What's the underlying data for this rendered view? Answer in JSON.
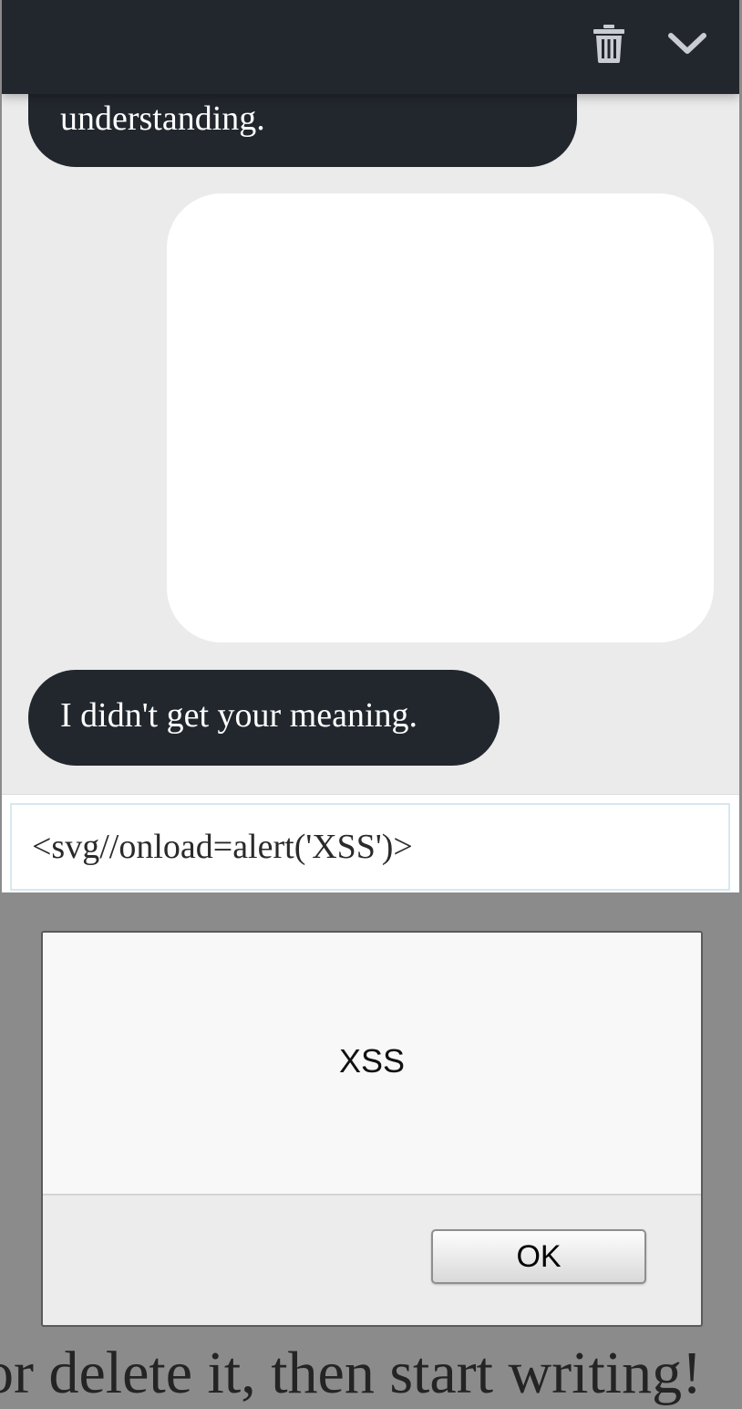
{
  "chat": {
    "header": {
      "delete_icon": "trash-icon",
      "collapse_icon": "chevron-down-icon",
      "background": "#22272e"
    },
    "messages": [
      {
        "from": "bot",
        "text": "understanding."
      },
      {
        "from": "user",
        "text": ""
      },
      {
        "from": "bot",
        "text": "I didn't get your meaning."
      }
    ],
    "input": {
      "value": "<svg//onload=alert('XSS')>"
    }
  },
  "alert": {
    "message": "XSS",
    "ok_label": "OK"
  },
  "page": {
    "background_text": "or delete it, then start writing!"
  }
}
